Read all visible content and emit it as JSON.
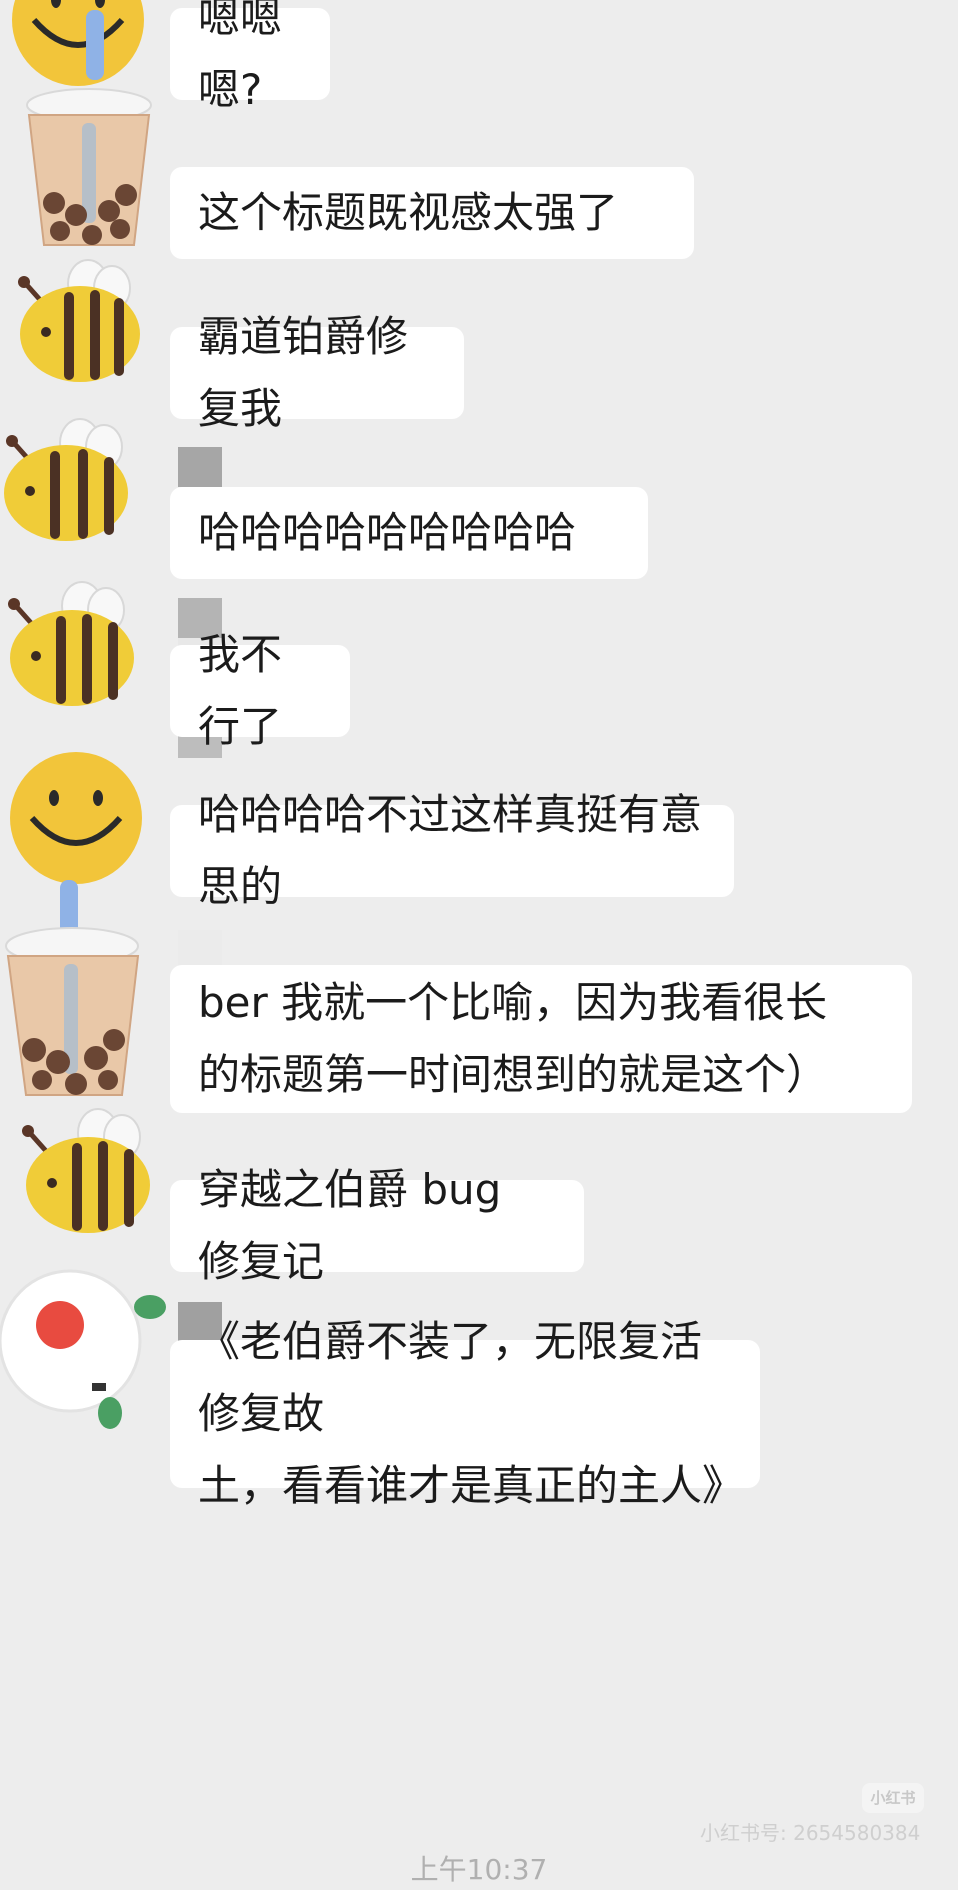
{
  "messages": [
    {
      "avatar": "smiley-face",
      "text": "嗯嗯嗯?"
    },
    {
      "avatar": "bubble-tea",
      "text": "这个标题既视感太强了"
    },
    {
      "avatar": "bee",
      "text": "霸道铂爵修复我"
    },
    {
      "avatar": "bee",
      "text": "哈哈哈哈哈哈哈哈哈"
    },
    {
      "avatar": "bee",
      "text": "我不行了"
    },
    {
      "avatar": "smiley-face",
      "text": "哈哈哈哈不过这样真挺有意思的"
    },
    {
      "avatar": "bubble-tea",
      "text": "ber 我就一个比喻，因为我看很长\n的标题第一时间想到的就是这个）"
    },
    {
      "avatar": "bee",
      "text": "穿越之伯爵 bug 修复记"
    },
    {
      "avatar": "white-flower",
      "text": "《老伯爵不装了，无限复活修复故\n土，看看谁才是真正的主人》"
    }
  ],
  "watermark": {
    "badge": "小红书",
    "text": "小红书号: 2654580384"
  },
  "timestamp": "上午10:37",
  "colors": {
    "background": "#ededed",
    "bubble": "#ffffff",
    "text": "#1b1b1b"
  }
}
